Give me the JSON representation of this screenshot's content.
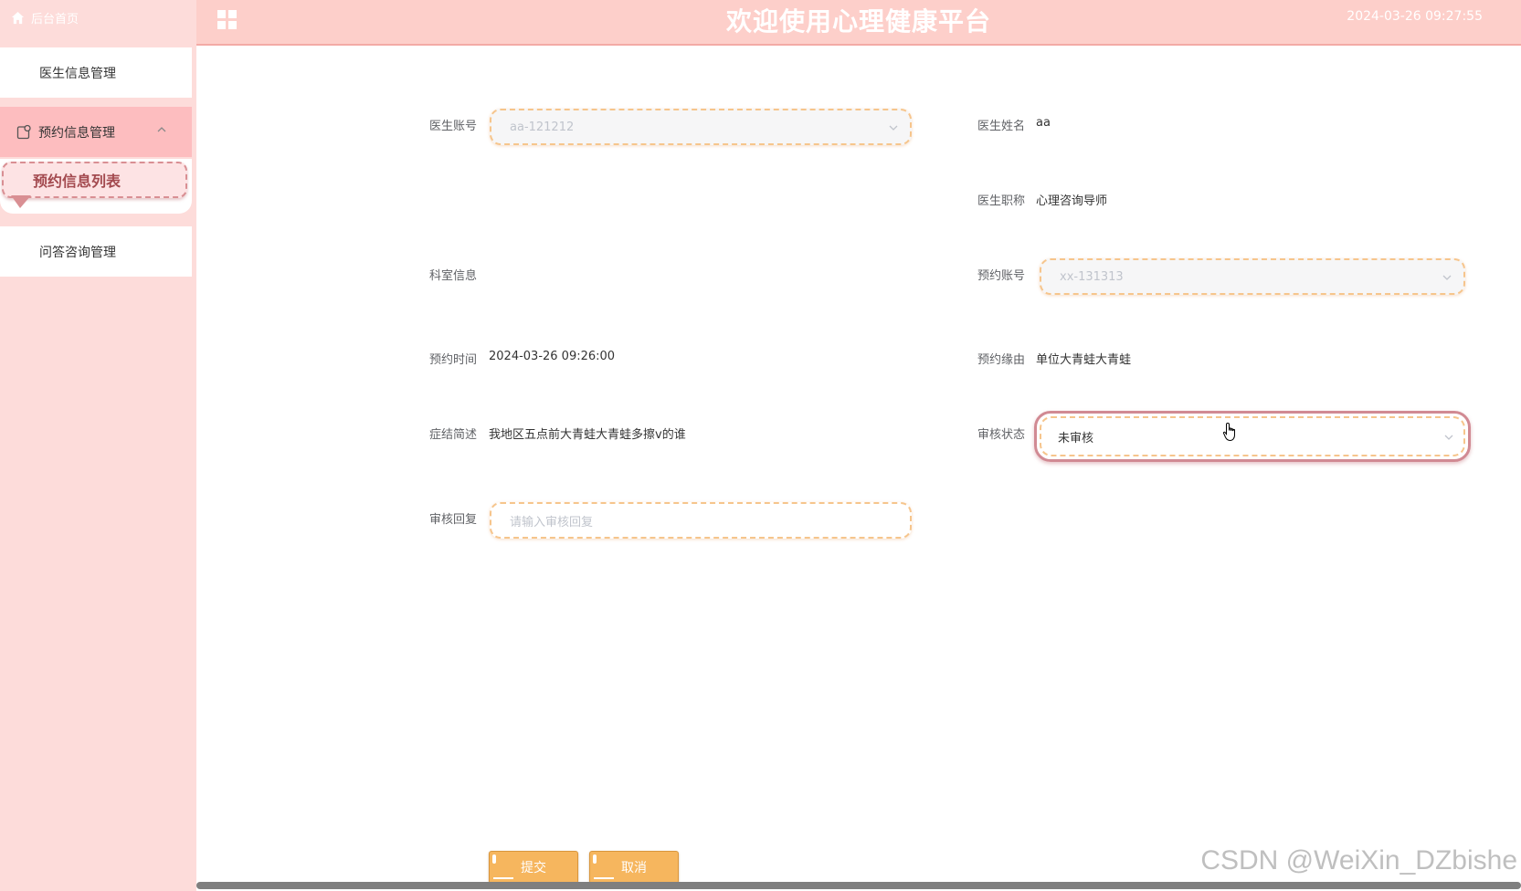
{
  "sidebar": {
    "home_label": "后台首页",
    "items": [
      {
        "label": "医生信息管理"
      },
      {
        "label": "预约信息管理",
        "expanded": true,
        "icon": "appointment-icon"
      },
      {
        "label": "问答咨询管理"
      }
    ],
    "submenu": {
      "label": "预约信息列表"
    }
  },
  "header": {
    "title": "欢迎使用心理健康平台",
    "datetime": "2024-03-26 09:27:55"
  },
  "form": {
    "doctor_account": {
      "label": "医生账号",
      "value": "aa-121212"
    },
    "doctor_name": {
      "label": "医生姓名",
      "value": "aa"
    },
    "doctor_title": {
      "label": "医生职称",
      "value": "心理咨询导师"
    },
    "department": {
      "label": "科室信息",
      "value": ""
    },
    "appointment_account": {
      "label": "预约账号",
      "value": "xx-131313"
    },
    "appointment_time": {
      "label": "预约时间",
      "value": "2024-03-26 09:26:00"
    },
    "appointment_reason": {
      "label": "预约缘由",
      "value": "单位大青蛙大青蛙"
    },
    "symptom": {
      "label": "症结简述",
      "value": "我地区五点前大青蛙大青蛙多擦v的谁"
    },
    "review_status": {
      "label": "审核状态",
      "value": "未审核"
    },
    "review_reply": {
      "label": "审核回复",
      "placeholder": "请输入审核回复"
    }
  },
  "buttons": {
    "submit": "提交",
    "cancel": "取消"
  },
  "watermark": "CSDN @WeiXin_DZbishe",
  "colors": {
    "sidebar_bg": "#fddcda",
    "header_bg": "#fdcfca",
    "active_menu": "#fdbdbf",
    "button": "#f6b65e",
    "field_border": "#f6c58c"
  }
}
